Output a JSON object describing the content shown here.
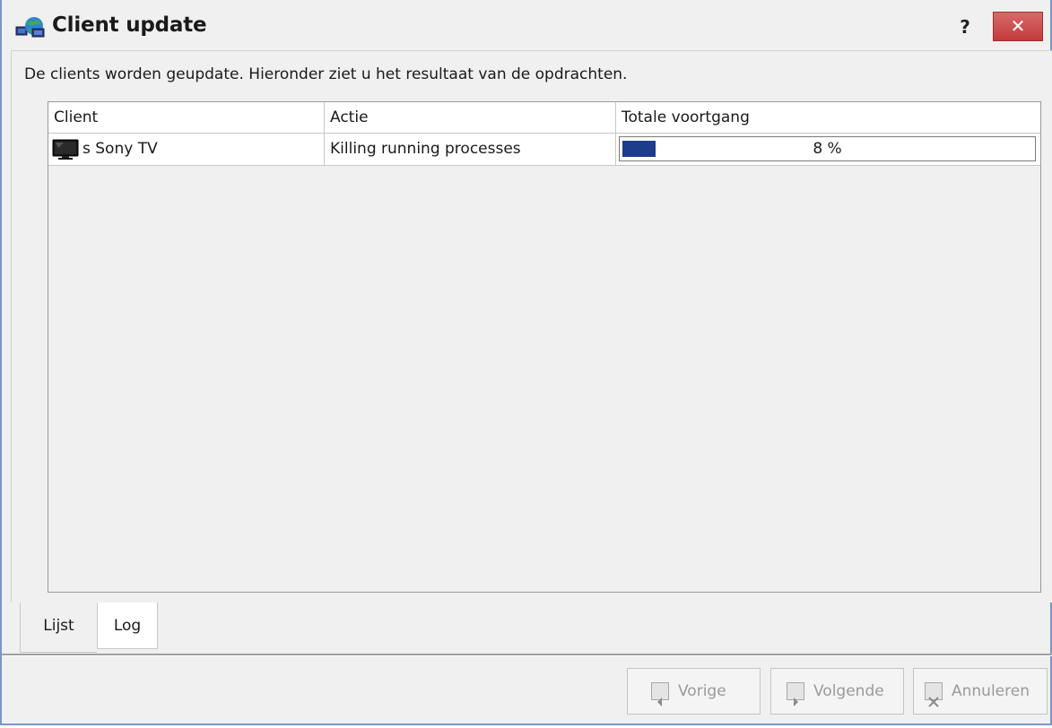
{
  "window": {
    "title": "Client update",
    "help_label": "?",
    "close_label": "✕"
  },
  "main": {
    "intro": "De clients worden geupdate. Hieronder ziet u het resultaat van de opdrachten.",
    "columns": [
      "Client",
      "Actie",
      "Totale voortgang"
    ],
    "rows": [
      {
        "client": "s Sony TV",
        "action": "Killing running processes",
        "progress": 8,
        "progress_label": "8 %"
      }
    ]
  },
  "tabs": [
    {
      "label": "Lijst",
      "active": true
    },
    {
      "label": "Log",
      "active": false
    }
  ],
  "footer": {
    "buttons": [
      {
        "label": "Vorige",
        "enabled": false,
        "icon": "arrow-left-icon"
      },
      {
        "label": "Volgende",
        "enabled": false,
        "icon": "arrow-right-icon"
      },
      {
        "label": "Annuleren",
        "enabled": false,
        "icon": "cancel-icon"
      }
    ]
  },
  "colors": {
    "progress_fill": "#1c3c8c",
    "close_button": "#c94747",
    "disabled_text": "#9a9a9a"
  }
}
